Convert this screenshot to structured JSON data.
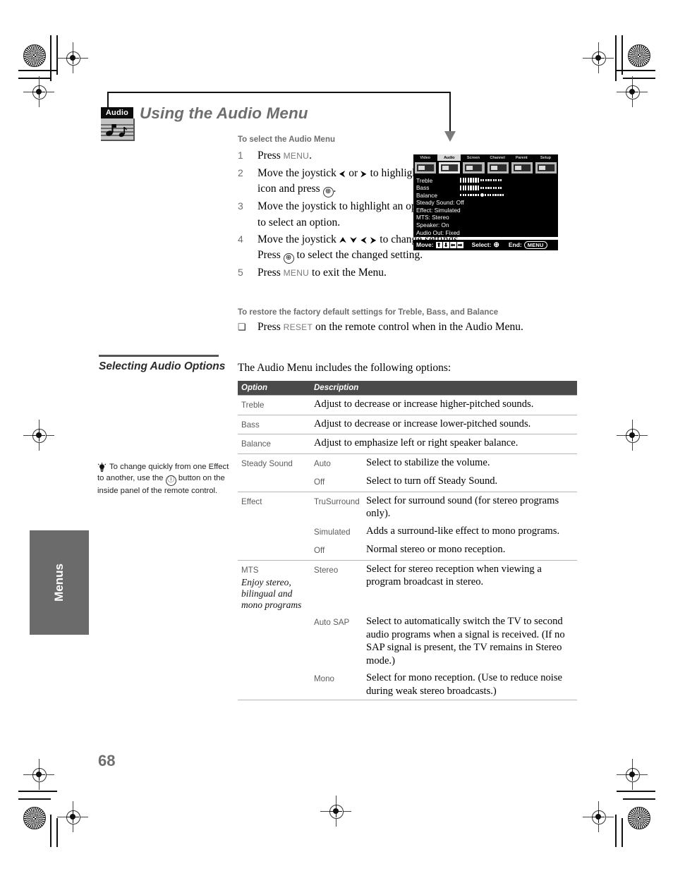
{
  "page": {
    "number": "68",
    "side_tab": "Menus",
    "title": "Using the Audio Menu",
    "badge_label": "Audio"
  },
  "procedure": {
    "heading": "To select the Audio Menu",
    "steps": [
      {
        "num": "1",
        "parts": [
          {
            "t": "text",
            "v": "Press "
          },
          {
            "t": "kbd",
            "v": "MENU"
          },
          {
            "t": "text",
            "v": "."
          }
        ]
      },
      {
        "num": "2",
        "parts": [
          {
            "t": "text",
            "v": "Move the joystick "
          },
          {
            "t": "glyph",
            "v": "⮜"
          },
          {
            "t": "text",
            "v": " or "
          },
          {
            "t": "glyph",
            "v": "⮞"
          },
          {
            "t": "text",
            "v": " to highlight the Audio icon and press "
          },
          {
            "t": "circle",
            "v": "⊕"
          },
          {
            "t": "text",
            "v": "."
          }
        ]
      },
      {
        "num": "3",
        "parts": [
          {
            "t": "text",
            "v": "Move the joystick to highlight an option. Press "
          },
          {
            "t": "circle",
            "v": "⊕"
          },
          {
            "t": "text",
            "v": " to select an option."
          }
        ]
      },
      {
        "num": "4",
        "parts": [
          {
            "t": "text",
            "v": "Move the joystick "
          },
          {
            "t": "glyph",
            "v": "⮝ ⮟ ⮜ ⮞"
          },
          {
            "t": "text",
            "v": " to change settings. Press "
          },
          {
            "t": "circle",
            "v": "⊕"
          },
          {
            "t": "text",
            "v": " to select the changed setting."
          }
        ]
      },
      {
        "num": "5",
        "parts": [
          {
            "t": "text",
            "v": "Press "
          },
          {
            "t": "kbd",
            "v": "MENU"
          },
          {
            "t": "text",
            "v": " to exit the Menu."
          }
        ]
      }
    ]
  },
  "restore": {
    "heading": "To restore the factory default settings for Treble, Bass, and Balance",
    "bullet": "❑",
    "parts": [
      {
        "t": "text",
        "v": "Press "
      },
      {
        "t": "kbd",
        "v": "RESET"
      },
      {
        "t": "text",
        "v": " on the remote control when in the Audio Menu."
      }
    ]
  },
  "tv_menu": {
    "tabs": [
      {
        "label": "Video",
        "selected": false,
        "icon": "video-icon"
      },
      {
        "label": "Audio",
        "selected": true,
        "icon": "audio-notes-icon"
      },
      {
        "label": "Screen",
        "selected": false,
        "icon": "screen-grid-icon"
      },
      {
        "label": "Channel",
        "selected": false,
        "icon": "channel-icon"
      },
      {
        "label": "Parent",
        "selected": false,
        "icon": "parent-icon"
      },
      {
        "label": "Setup",
        "selected": false,
        "icon": "setup-icon"
      }
    ],
    "rows": [
      {
        "name": "Treble",
        "type": "bar",
        "filled": 8,
        "total": 17
      },
      {
        "name": "Bass",
        "type": "bar",
        "filled": 8,
        "total": 17
      },
      {
        "name": "Balance",
        "type": "knob",
        "filled": 8,
        "total": 17
      },
      {
        "name": "Steady Sound: Off",
        "type": "text"
      },
      {
        "name": "Effect: Simulated",
        "type": "text"
      },
      {
        "name": "MTS: Stereo",
        "type": "text"
      },
      {
        "name": "Speaker: On",
        "type": "text"
      },
      {
        "name": "Audio Out: Fixed",
        "type": "text"
      }
    ],
    "footer": {
      "move_label": "Move:",
      "arrows": [
        "⬆",
        "⬇",
        "⬅",
        "➡"
      ],
      "select_label": "Select:",
      "select_glyph": "⊕",
      "end_label": "End:",
      "end_key": "MENU"
    }
  },
  "section": {
    "title": "Selecting Audio Options",
    "intro": "The Audio Menu includes the following options:"
  },
  "tip": {
    "icon": "lightbulb-icon",
    "text_before": "To change quickly from one Effect to another, use the ",
    "glyph": "ⓘ",
    "text_after": " button on the inside panel of the remote control."
  },
  "table": {
    "headers": {
      "option": "Option",
      "description": "Description"
    },
    "rows": [
      {
        "option": "Treble",
        "sub": "",
        "desc": "Adjust to decrease or increase higher-pitched sounds.",
        "span": true
      },
      {
        "option": "Bass",
        "sub": "",
        "desc": "Adjust to decrease or increase lower-pitched sounds.",
        "span": true
      },
      {
        "option": "Balance",
        "sub": "",
        "desc": "Adjust to emphasize left or right speaker balance.",
        "span": true
      },
      {
        "option": "Steady Sound",
        "sub": "Auto",
        "desc": "Select to stabilize the volume.",
        "span": false
      },
      {
        "option": "",
        "sub": "Off",
        "desc": "Select to turn off Steady Sound.",
        "span": false
      },
      {
        "option": "Effect",
        "sub": "TruSurround",
        "desc": "Select for surround sound (for stereo programs only).",
        "span": false
      },
      {
        "option": "",
        "sub": "Simulated",
        "desc": "Adds a surround-like effect to mono programs.",
        "span": false
      },
      {
        "option": "",
        "sub": "Off",
        "desc": "Normal stereo or mono reception.",
        "span": false
      },
      {
        "option": "MTS",
        "option_italic": "Enjoy stereo, bilingual and mono programs",
        "sub": "Stereo",
        "desc": "Select for stereo reception when viewing a program broadcast in stereo.",
        "span": false
      },
      {
        "option": "",
        "sub": "Auto SAP",
        "desc": "Select to automatically switch the TV to second audio programs when a signal is received. (If no SAP signal is present, the TV remains in Stereo mode.)",
        "span": false
      },
      {
        "option": "",
        "sub": "Mono",
        "desc": "Select for mono reception. (Use to reduce noise during weak stereo broadcasts.)",
        "span": false
      }
    ]
  },
  "colors": {
    "title_gray": "#6e6e6e",
    "table_header_bg": "#4a4a4a",
    "side_tab_bg": "#6b6b6b",
    "rule_gray": "#b5b5b5"
  }
}
